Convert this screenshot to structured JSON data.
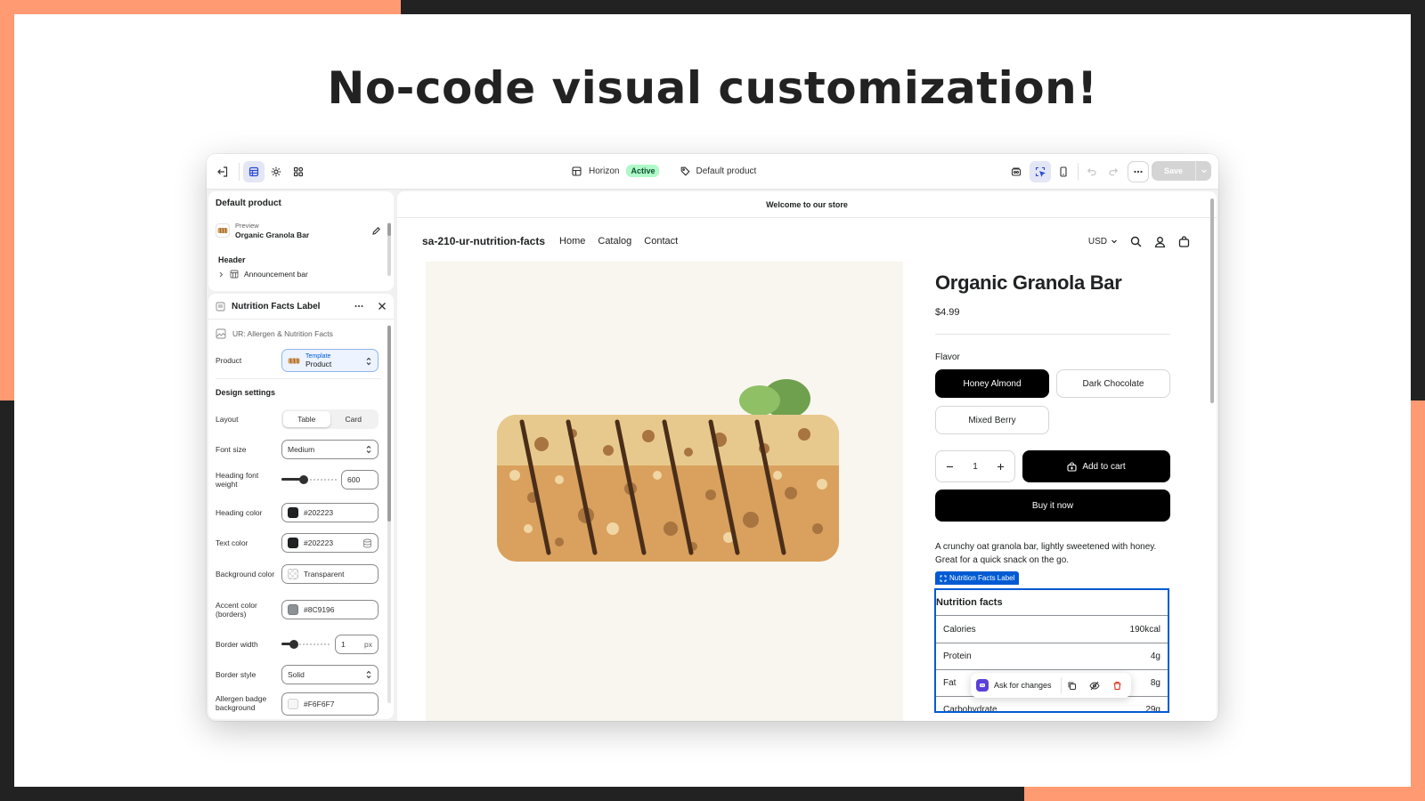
{
  "headline": "No-code visual customization!",
  "colors": {
    "accent_orange": "#FF9A73",
    "dark": "#222222",
    "editor_blue": "#005BD3",
    "active_badge": "#AFF8C8"
  },
  "topbar": {
    "theme_name": "Horizon",
    "theme_status": "Active",
    "template_name": "Default product",
    "save_label": "Save",
    "icons_left": [
      "exit-icon",
      "sections-icon",
      "settings-gear-icon",
      "apps-icon"
    ],
    "icons_right": [
      "inspector-icon",
      "select-element-icon",
      "mobile-view-icon",
      "undo-icon",
      "redo-icon",
      "more-icon"
    ]
  },
  "sections_panel": {
    "title": "Default product",
    "preview_label": "Preview",
    "preview_product": "Organic Granola Bar",
    "group_header": "Header",
    "announcement_item": "Announcement bar"
  },
  "settings_panel": {
    "block_title": "Nutrition Facts Label",
    "app_name": "UR: Allergen & Nutrition Facts",
    "product_label": "Product",
    "product_picker_top": "Template",
    "product_picker_value": "Product",
    "design_heading": "Design settings",
    "layout_label": "Layout",
    "layout_options": [
      "Table",
      "Card"
    ],
    "layout_selected": "Table",
    "font_size_label": "Font size",
    "font_size_value": "Medium",
    "heading_weight_label": "Heading font weight",
    "heading_weight_value": "600",
    "heading_weight_fraction": 0.4,
    "heading_color_label": "Heading color",
    "heading_color_value": "#202223",
    "text_color_label": "Text color",
    "text_color_value": "#202223",
    "bg_color_label": "Background color",
    "bg_color_value": "Transparent",
    "accent_label": "Accent color (borders)",
    "accent_value": "#8C9196",
    "border_width_label": "Border width",
    "border_width_value": "1",
    "border_width_unit": "px",
    "border_width_fraction": 0.25,
    "border_style_label": "Border style",
    "border_style_value": "Solid",
    "allergen_bg_label": "Allergen badge background",
    "allergen_bg_value": "#F6F6F7"
  },
  "store": {
    "announcement": "Welcome to our store",
    "brand": "sa-210-ur-nutrition-facts",
    "nav": [
      "Home",
      "Catalog",
      "Contact"
    ],
    "currency": "USD",
    "product_title": "Organic Granola Bar",
    "price": "$4.99",
    "flavor_label": "Flavor",
    "flavors": [
      "Honey Almond",
      "Dark Chocolate",
      "Mixed Berry"
    ],
    "flavor_selected": "Honey Almond",
    "quantity": "1",
    "add_to_cart": "Add to cart",
    "buy_now": "Buy it now",
    "description": "A crunchy oat granola bar, lightly sweetened with honey. Great for a quick snack on the go."
  },
  "nutrition": {
    "tag": "Nutrition Facts Label",
    "title": "Nutrition facts",
    "rows": [
      {
        "name": "Calories",
        "value": "190kcal"
      },
      {
        "name": "Protein",
        "value": "4g"
      },
      {
        "name": "Fat",
        "value": "8g"
      },
      {
        "name": "Carbohydrate",
        "value": "29g"
      }
    ]
  },
  "ask_bar": {
    "label": "Ask for changes"
  }
}
